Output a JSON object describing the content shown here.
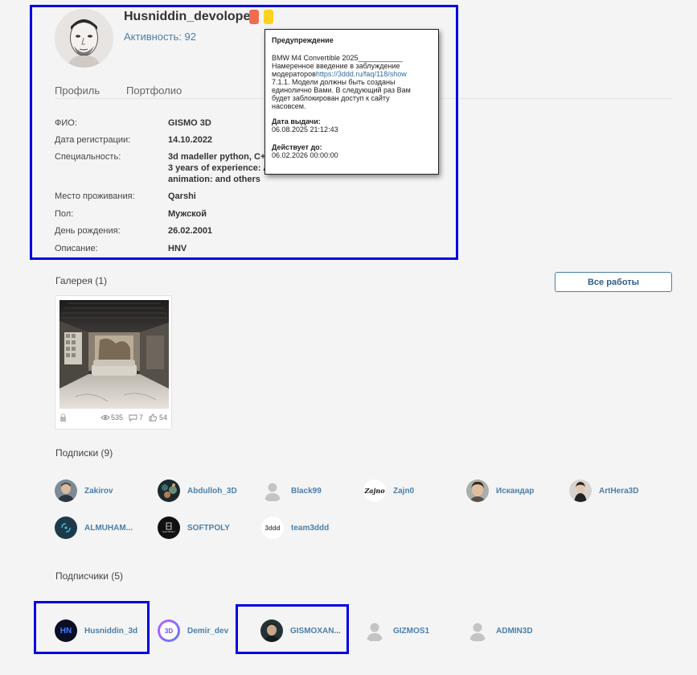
{
  "profile": {
    "username": "Husniddin_devoloper",
    "activity_label": "Активность:",
    "activity_value": "92",
    "badge_colors": [
      "#ef6c4f",
      "#ffd21f"
    ]
  },
  "tabs": [
    "Профиль",
    "Портфолио"
  ],
  "details": [
    {
      "label": "ФИО:",
      "value": "GISMO 3D"
    },
    {
      "label": "Дата регистрации:",
      "value": "14.10.2022"
    },
    {
      "label": "Специальность:",
      "value_lines": [
        "3d madeller python, C++ J",
        "3 years of experience: An",
        "animation: and others"
      ]
    },
    {
      "label": "Место проживания:",
      "value": "Qarshi"
    },
    {
      "label": "Пол:",
      "value": "Мужской"
    },
    {
      "label": "День рождения:",
      "value": "26.02.2001"
    },
    {
      "label": "Описание:",
      "value": "HNV"
    }
  ],
  "tooltip": {
    "title": "Предупреждение",
    "line1": "BMW M4 Convertible 2025___________",
    "line2": "Намеренное введение в заблуждение",
    "line3_prefix": "модераторов",
    "line3_link": "https://3ddd.ru/faq/118/show",
    "line4": "7.1.1. Модели должны быть созданы",
    "line5": "единолично Вами. В следующий раз Вам",
    "line6": "будет заблокирован доступ к сайту",
    "line7": "насовсем.",
    "issued_label": "Дата выдачи:",
    "issued_value": "06.08.2025 21:12:43",
    "valid_label": "Действует до:",
    "valid_value": "06.02.2026 00:00:00"
  },
  "gallery": {
    "title": "Галерея (1)",
    "all_works": "Все работы",
    "item": {
      "views": "535",
      "comments": "7",
      "likes": "54"
    }
  },
  "subscriptions": {
    "title": "Подписки (9)",
    "people": [
      "Zakirov",
      "Abdulloh_3D",
      "Black99",
      "Zajn0",
      "Искандар",
      "ArtHera3D",
      "ALMUHAM...",
      "SOFTPOLY",
      "team3ddd"
    ]
  },
  "subscribers": {
    "title": "Подписчики (5)",
    "people": [
      "Husniddin_3d",
      "Demir_dev",
      "GISMOXAN...",
      "GIZMOS1",
      "ADMIN3D"
    ]
  },
  "avatar_texts": {
    "zajno": "Zajno",
    "team3ddd": "3ddd",
    "demir": "3D",
    "softpoly": "SOFTPOLY",
    "husniddin": "HN"
  },
  "highlight_color": "#0000e6"
}
